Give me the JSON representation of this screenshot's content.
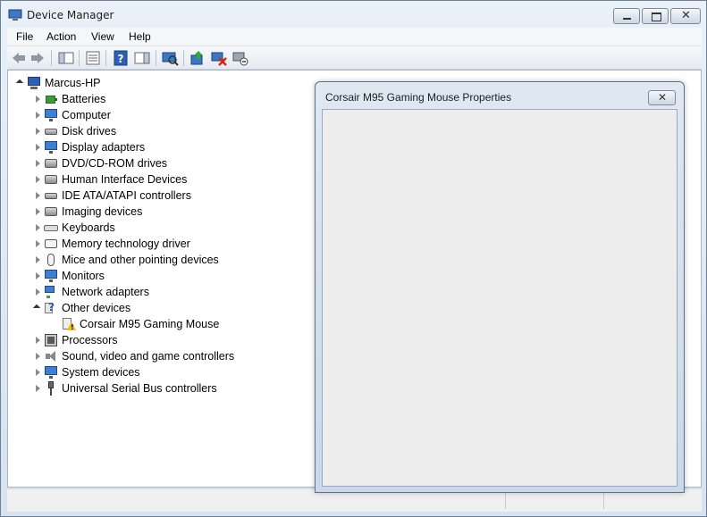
{
  "window": {
    "title": "Device Manager"
  },
  "menu": [
    "File",
    "Action",
    "View",
    "Help"
  ],
  "toolbar": {
    "buttons": [
      "back-icon",
      "forward-icon",
      "show-hide-console-tree-icon",
      "properties-icon",
      "help-icon",
      "action-pane-icon",
      "scan-hardware-icon",
      "update-driver-icon",
      "uninstall-icon",
      "disable-icon"
    ]
  },
  "tree": {
    "root": "Marcus-HP",
    "items": [
      {
        "label": "Batteries",
        "icon": "battery"
      },
      {
        "label": "Computer",
        "icon": "computer"
      },
      {
        "label": "Disk drives",
        "icon": "disk"
      },
      {
        "label": "Display adapters",
        "icon": "monitor"
      },
      {
        "label": "DVD/CD-ROM drives",
        "icon": "dvd"
      },
      {
        "label": "Human Interface Devices",
        "icon": "hid"
      },
      {
        "label": "IDE ATA/ATAPI controllers",
        "icon": "ide"
      },
      {
        "label": "Imaging devices",
        "icon": "imaging"
      },
      {
        "label": "Keyboards",
        "icon": "keyboard"
      },
      {
        "label": "Memory technology driver",
        "icon": "memory"
      },
      {
        "label": "Mice and other pointing devices",
        "icon": "mouse"
      },
      {
        "label": "Monitors",
        "icon": "monitor"
      },
      {
        "label": "Network adapters",
        "icon": "network"
      },
      {
        "label": "Other devices",
        "icon": "other"
      },
      {
        "label": "Corsair M95 Gaming Mouse",
        "icon": "warning-device"
      },
      {
        "label": "Processors",
        "icon": "cpu"
      },
      {
        "label": "Sound, video and game controllers",
        "icon": "speaker"
      },
      {
        "label": "System devices",
        "icon": "computer"
      },
      {
        "label": "Universal Serial Bus controllers",
        "icon": "usb"
      }
    ]
  },
  "dialog": {
    "title": "Corsair M95 Gaming Mouse Properties"
  }
}
